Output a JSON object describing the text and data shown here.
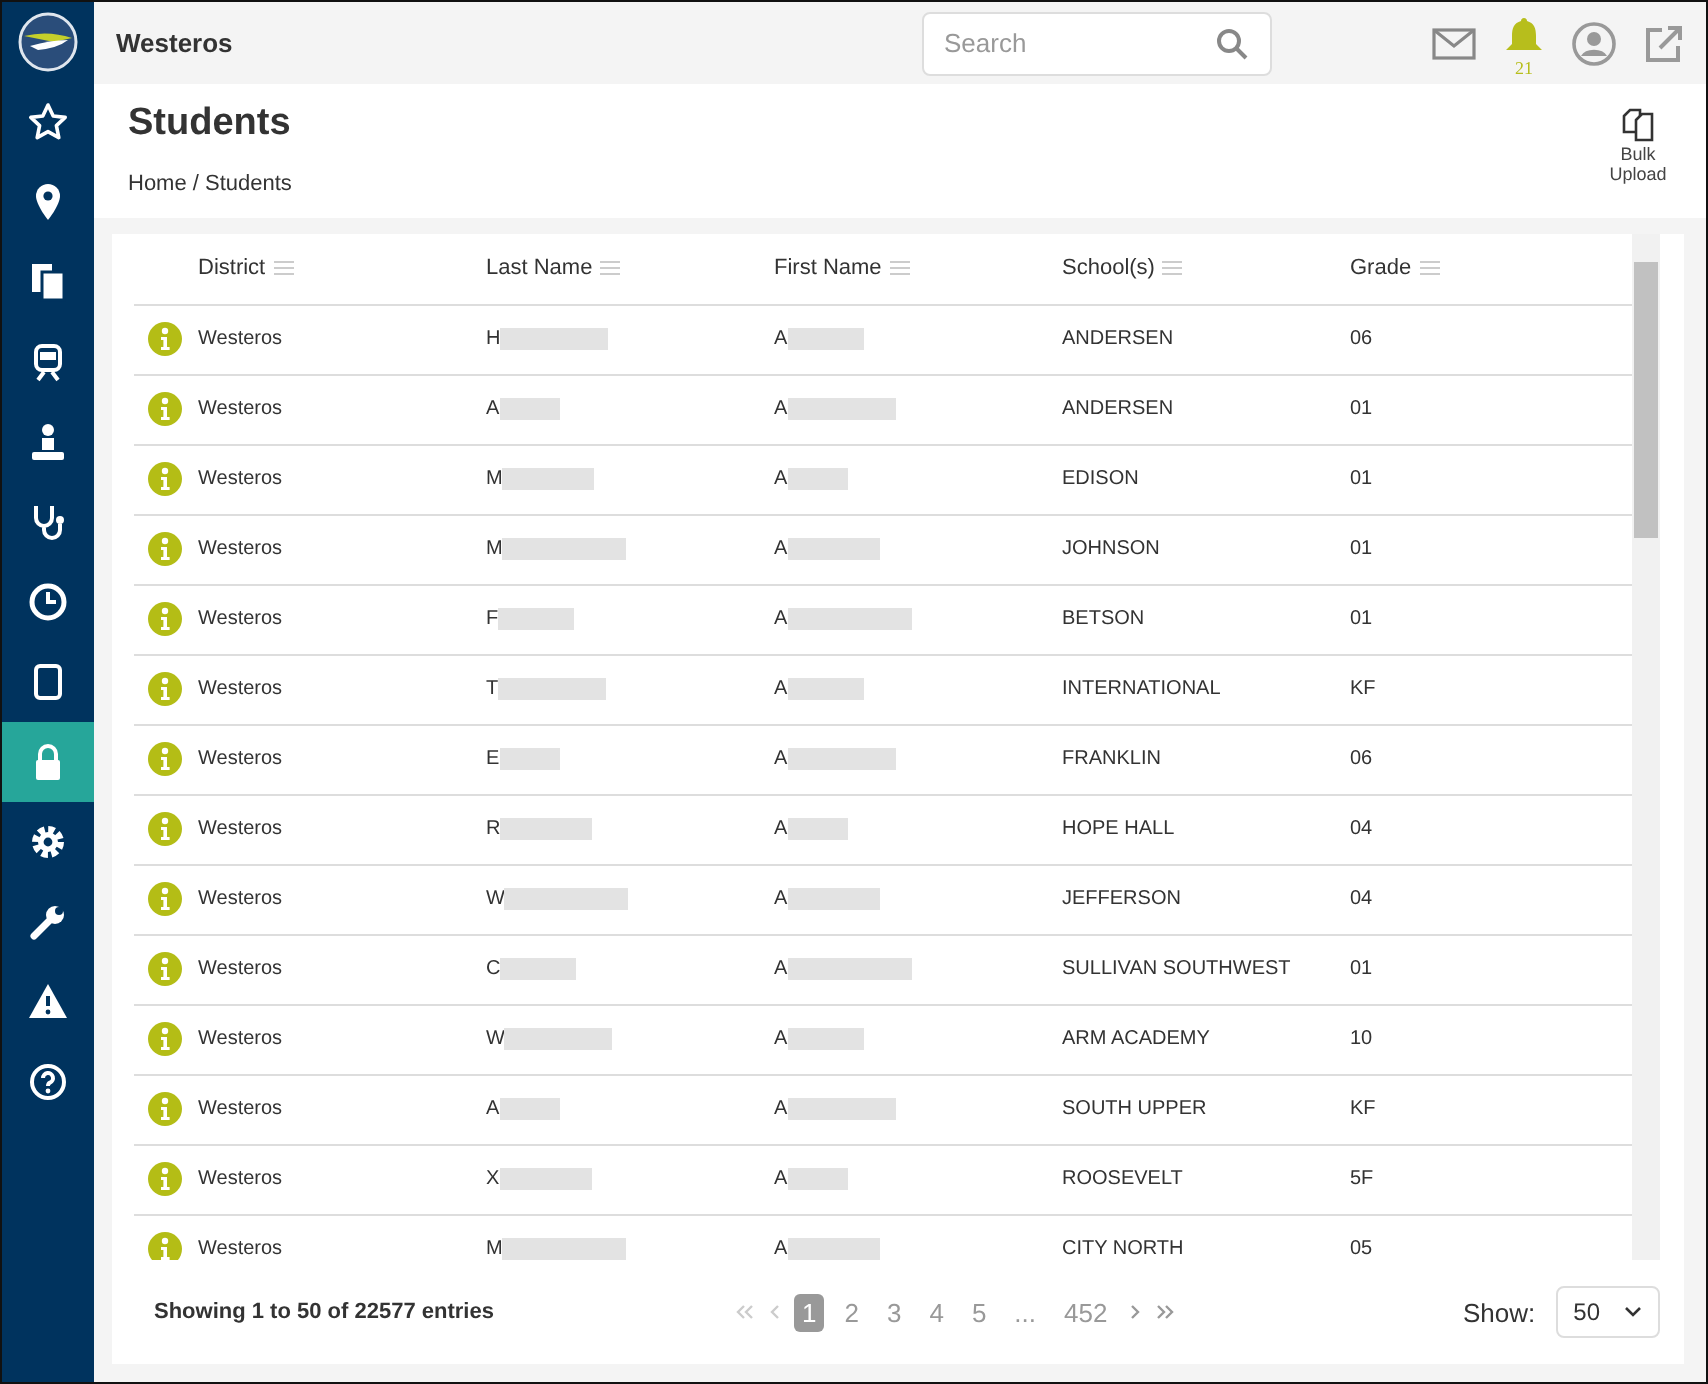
{
  "sidebar": {
    "items": [
      {
        "kind": "star",
        "selected": false
      },
      {
        "kind": "pin",
        "selected": false
      },
      {
        "kind": "documents",
        "selected": false
      },
      {
        "kind": "train",
        "selected": false
      },
      {
        "kind": "person",
        "selected": false
      },
      {
        "kind": "stethoscope",
        "selected": false
      },
      {
        "kind": "clock",
        "selected": false
      },
      {
        "kind": "tablet",
        "selected": false
      },
      {
        "kind": "lock",
        "selected": true
      },
      {
        "kind": "gear",
        "selected": false
      },
      {
        "kind": "wrench",
        "selected": false
      },
      {
        "kind": "warning",
        "selected": false
      },
      {
        "kind": "help",
        "selected": false
      }
    ]
  },
  "header": {
    "title": "Westeros",
    "search": {
      "placeholder": "Search"
    },
    "notifications": "21"
  },
  "page": {
    "title": "Students",
    "breadcrumb": "Home / Students",
    "bulk_upload": "Bulk Upload"
  },
  "table": {
    "columns": [
      "District",
      "Last Name",
      "First Name",
      "School(s)",
      "Grade"
    ],
    "rows": [
      {
        "district": "Westeros",
        "last_initial": "H",
        "first_initial": "A",
        "school": "ANDERSEN",
        "grade": "06"
      },
      {
        "district": "Westeros",
        "last_initial": "A",
        "first_initial": "A",
        "school": "ANDERSEN",
        "grade": "01"
      },
      {
        "district": "Westeros",
        "last_initial": "M",
        "first_initial": "A",
        "school": "EDISON",
        "grade": "01"
      },
      {
        "district": "Westeros",
        "last_initial": "M",
        "first_initial": "A",
        "school": "JOHNSON",
        "grade": "01"
      },
      {
        "district": "Westeros",
        "last_initial": "F",
        "first_initial": "A",
        "school": "BETSON",
        "grade": "01"
      },
      {
        "district": "Westeros",
        "last_initial": "T",
        "first_initial": "A",
        "school": "INTERNATIONAL",
        "grade": "KF"
      },
      {
        "district": "Westeros",
        "last_initial": "E",
        "first_initial": "A",
        "school": "FRANKLIN",
        "grade": "06"
      },
      {
        "district": "Westeros",
        "last_initial": "R",
        "first_initial": "A",
        "school": "HOPE HALL",
        "grade": "04"
      },
      {
        "district": "Westeros",
        "last_initial": "W",
        "first_initial": "A",
        "school": "JEFFERSON",
        "grade": "04"
      },
      {
        "district": "Westeros",
        "last_initial": "C",
        "first_initial": "A",
        "school": "SULLIVAN SOUTHWEST",
        "grade": "01"
      },
      {
        "district": "Westeros",
        "last_initial": "W",
        "first_initial": "A",
        "school": "ARM ACADEMY",
        "grade": "10"
      },
      {
        "district": "Westeros",
        "last_initial": "A",
        "first_initial": "A",
        "school": "SOUTH UPPER",
        "grade": "KF"
      },
      {
        "district": "Westeros",
        "last_initial": "X",
        "first_initial": "A",
        "school": "ROOSEVELT",
        "grade": "5F"
      },
      {
        "district": "Westeros",
        "last_initial": "M",
        "first_initial": "A",
        "school": "CITY NORTH",
        "grade": "05"
      }
    ]
  },
  "footer": {
    "summary": "Showing 1 to 50 of 22577 entries",
    "pages": [
      {
        "label": "1",
        "selected": true
      },
      {
        "label": "2",
        "selected": false
      },
      {
        "label": "3",
        "selected": false
      },
      {
        "label": "4",
        "selected": false
      },
      {
        "label": "5",
        "selected": false
      },
      {
        "label": "...",
        "selected": false
      },
      {
        "label": "452",
        "selected": false
      }
    ],
    "show_label": "Show:",
    "show_value": "50"
  }
}
